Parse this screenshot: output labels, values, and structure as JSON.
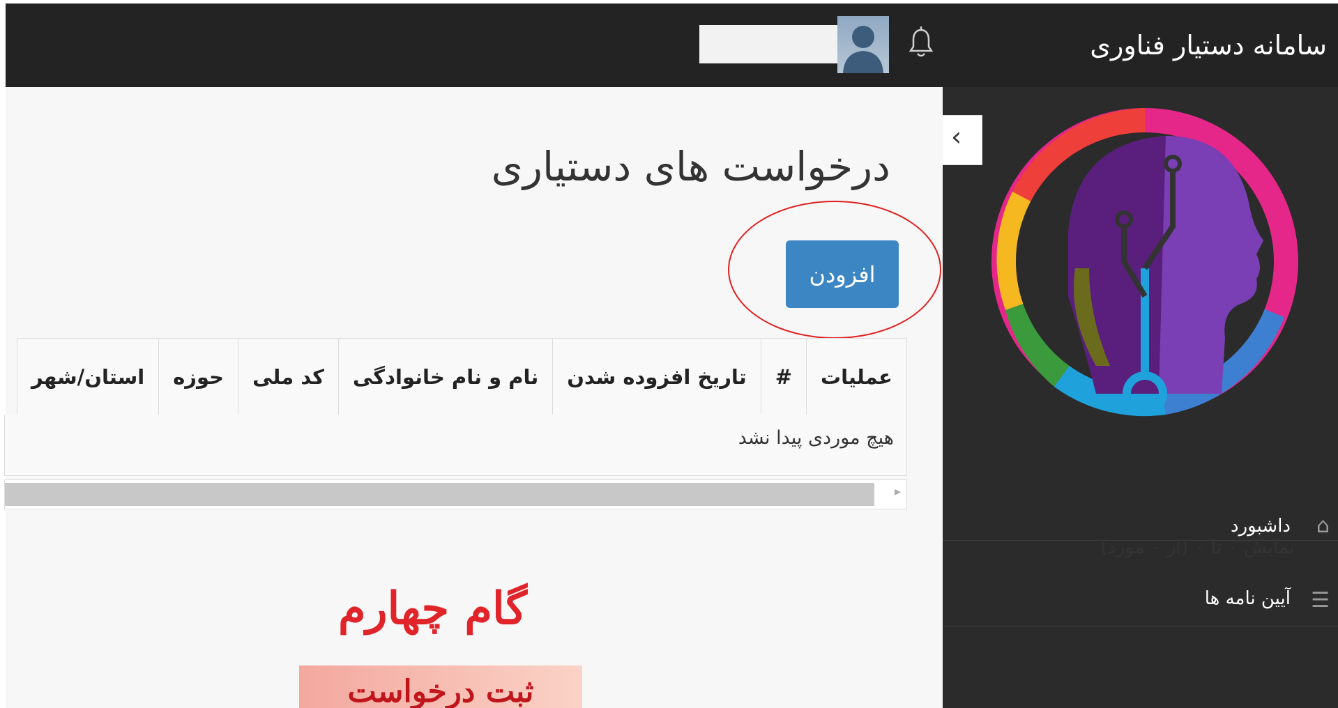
{
  "app": {
    "title": "سامانه دستیار فناوری"
  },
  "header": {
    "bell_icon": "bell-icon",
    "avatar_icon": "user-avatar",
    "username": ""
  },
  "sidebar": {
    "items": [
      {
        "label": "داشبورد",
        "icon": "home-icon"
      },
      {
        "label": "آیین نامه ها",
        "icon": "menu-icon"
      }
    ],
    "collapse_icon": "chevron-left-icon"
  },
  "main": {
    "title": "درخواست های دستیاری",
    "add_button": "افزودن",
    "table": {
      "columns": [
        "عملیات",
        "#",
        "تاریخ افزوده شدن",
        "نام و نام خانوادگی",
        "کد ملی",
        "حوزه",
        "استان/شهر"
      ],
      "empty_message": "هیچ موردی پیدا نشد"
    },
    "info": "نمایش ۰ تا ۰ (از ۰ مورد)"
  },
  "annotation": {
    "step_title": "گام چهارم",
    "step_subtitle": "ثبت درخواست"
  },
  "colors": {
    "topbar": "#232323",
    "sidebar": "#2b2b2b",
    "primary_button": "#3c86c3",
    "annotation_red": "#e0242a"
  }
}
